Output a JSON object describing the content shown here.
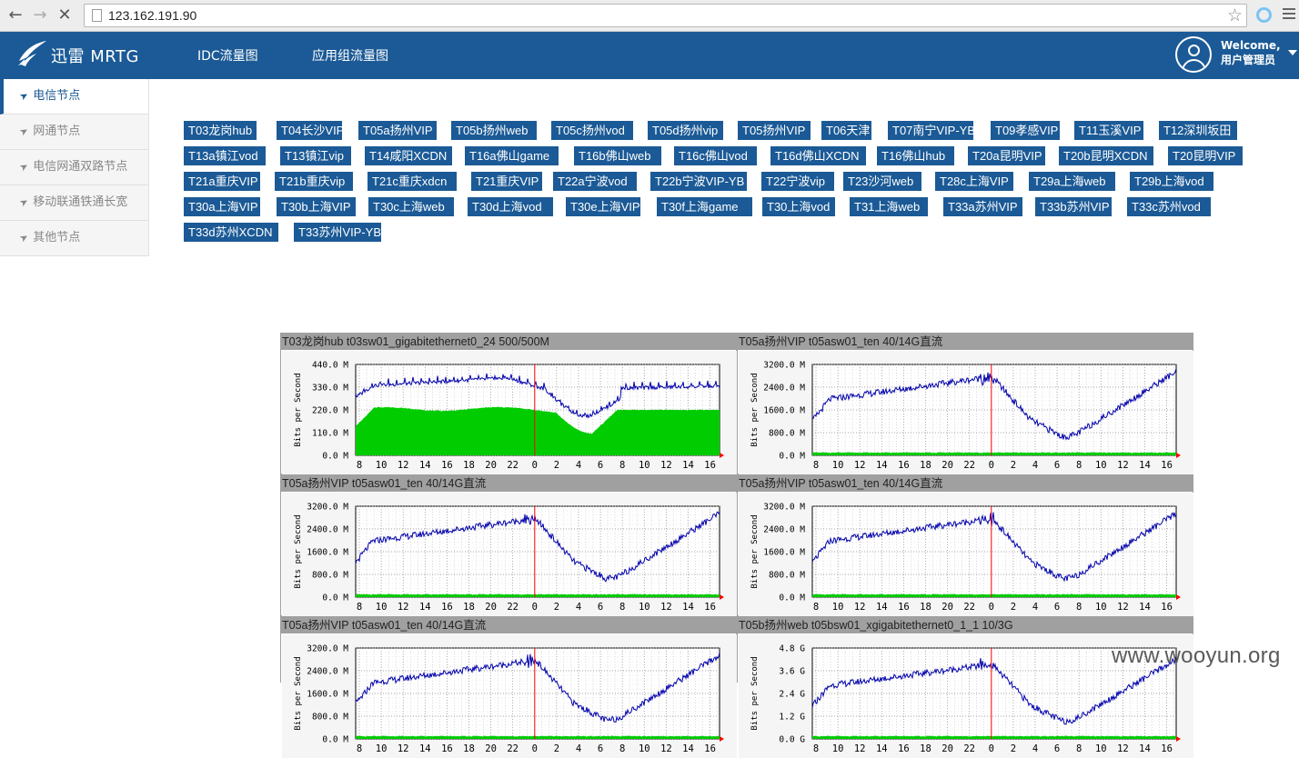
{
  "browser": {
    "url": "123.162.191.90"
  },
  "header": {
    "brand": "迅雷 MRTG",
    "nav": [
      "IDC流量图",
      "应用组流量图"
    ],
    "user": {
      "welcome": "Welcome,",
      "name": "用户管理员"
    }
  },
  "sidebar": {
    "items": [
      {
        "label": "电信节点",
        "active": true
      },
      {
        "label": "网通节点",
        "active": false
      },
      {
        "label": "电信网通双路节点",
        "active": false
      },
      {
        "label": "移动联通铁通长宽",
        "active": false
      },
      {
        "label": "其他节点",
        "active": false
      }
    ]
  },
  "tag_rows": [
    [
      "T03龙岗hub",
      "T04长沙VIP",
      "T05a扬州VIP",
      "T05b扬州web",
      "T05c扬州vod",
      "T05d扬州vip",
      "T05扬州VIP",
      "T06天津",
      "T07南宁VIP-YB",
      "T09孝感VIP",
      "T11玉溪VIP",
      "T12深圳坂田"
    ],
    [
      "T13a镇江vod",
      "T13镇江vip",
      "T14咸阳XCDN",
      "T16a佛山game",
      "T16b佛山web",
      "T16c佛山vod",
      "T16d佛山XCDN",
      "T16佛山hub",
      "T20a昆明VIP",
      "T20b昆明XCDN",
      "T20昆明VIP"
    ],
    [
      "T21a重庆VIP",
      "T21b重庆vip",
      "T21c重庆xdcn",
      "T21重庆VIP",
      "T22a宁波vod",
      "T22b宁波VIP-YB",
      "T22宁波vip",
      "T23沙河web",
      "T28c上海VIP",
      "T29a上海web",
      "T29b上海vod"
    ],
    [
      "T30a上海VIP",
      "T30b上海VIP",
      "T30c上海web",
      "T30d上海vod",
      "T30e上海VIP",
      "T30f上海game",
      "T30上海vod",
      "T31上海web",
      "T33a苏州VIP",
      "T33b苏州VIP",
      "T33c苏州vod"
    ],
    [
      "T33d苏州XCDN",
      "T33苏州VIP-YB"
    ]
  ],
  "graphs": [
    {
      "title": "T03龙岗hub t03sw01_gigabitethernet0_24 500/500M",
      "yticks": [
        "440.0 M",
        "330.0 M",
        "220.0 M",
        "110.0 M",
        "0.0 M"
      ],
      "ymax": 440,
      "ylabel": "Bits per Second",
      "profile": "hub"
    },
    {
      "title": "T05a扬州VIP t05asw01_ten 40/14G直流",
      "yticks": [
        "3200.0 M",
        "2400.0 M",
        "1600.0 M",
        "800.0 M",
        "0.0 M"
      ],
      "ymax": 3200,
      "ylabel": "Bits per Second",
      "profile": "ten"
    },
    {
      "title": "T05a扬州VIP t05asw01_ten 40/14G直流",
      "yticks": [
        "3200.0 M",
        "2400.0 M",
        "1600.0 M",
        "800.0 M",
        "0.0 M"
      ],
      "ymax": 3200,
      "ylabel": "Bits per Second",
      "profile": "ten"
    },
    {
      "title": "T05a扬州VIP t05asw01_ten 40/14G直流",
      "yticks": [
        "3200.0 M",
        "2400.0 M",
        "1600.0 M",
        "800.0 M",
        "0.0 M"
      ],
      "ymax": 3200,
      "ylabel": "Bits per Second",
      "profile": "ten"
    },
    {
      "title": "T05a扬州VIP t05asw01_ten 40/14G直流",
      "yticks": [
        "3200.0 M",
        "2400.0 M",
        "1600.0 M",
        "800.0 M",
        "0.0 M"
      ],
      "ymax": 3200,
      "ylabel": "Bits per Second",
      "profile": "ten"
    },
    {
      "title": "T05b扬州web t05bsw01_xgigabitethernet0_1_1 10/3G",
      "yticks": [
        "4.8 G",
        "3.6 G",
        "2.4 G",
        "1.2 G",
        "0.0 G"
      ],
      "ymax": 4.8,
      "ylabel": "Bits per Second",
      "profile": "web"
    }
  ],
  "xticks": [
    "8",
    "10",
    "12",
    "14",
    "16",
    "18",
    "20",
    "22",
    "0",
    "2",
    "4",
    "6",
    "8",
    "10",
    "12",
    "14",
    "16"
  ],
  "colors": {
    "nav": "#1b5a96",
    "in": "#00cc00",
    "out": "#0000aa",
    "marker": "#ff0000"
  },
  "watermark": "www.wooyun.org"
}
